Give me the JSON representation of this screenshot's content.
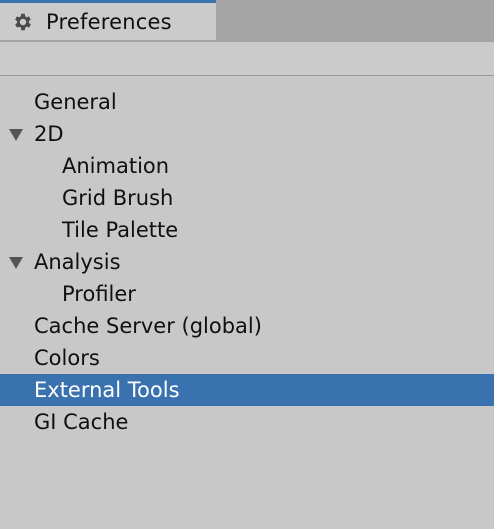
{
  "window": {
    "tab_title": "Preferences",
    "tab_icon": "gear-icon",
    "accent_color": "#3a72b0"
  },
  "sidebar": {
    "items": [
      {
        "label": "General",
        "level": 0,
        "expanded": null,
        "selected": false
      },
      {
        "label": "2D",
        "level": 0,
        "expanded": true,
        "selected": false
      },
      {
        "label": "Animation",
        "level": 1,
        "expanded": null,
        "selected": false
      },
      {
        "label": "Grid Brush",
        "level": 1,
        "expanded": null,
        "selected": false
      },
      {
        "label": "Tile Palette",
        "level": 1,
        "expanded": null,
        "selected": false
      },
      {
        "label": "Analysis",
        "level": 0,
        "expanded": true,
        "selected": false
      },
      {
        "label": "Profiler",
        "level": 1,
        "expanded": null,
        "selected": false
      },
      {
        "label": "Cache Server (global)",
        "level": 0,
        "expanded": null,
        "selected": false
      },
      {
        "label": "Colors",
        "level": 0,
        "expanded": null,
        "selected": false
      },
      {
        "label": "External Tools",
        "level": 0,
        "expanded": null,
        "selected": true
      },
      {
        "label": "GI Cache",
        "level": 0,
        "expanded": null,
        "selected": false
      }
    ]
  }
}
